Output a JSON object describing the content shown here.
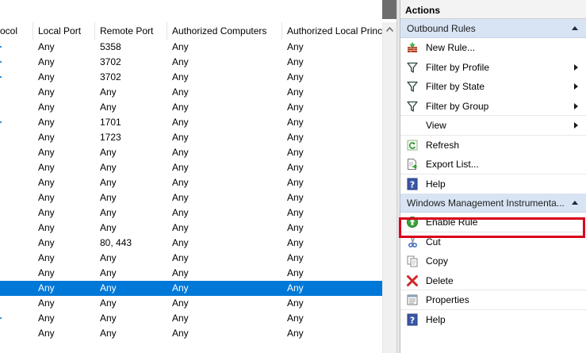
{
  "columns": [
    "ocol",
    "Local Port",
    "Remote Port",
    "Authorized Computers",
    "Authorized Local Princ"
  ],
  "rows": [
    {
      "tick": true,
      "local_port": "Any",
      "remote_port": "5358",
      "auth_computers": "Any",
      "auth_local": "Any",
      "selected": false
    },
    {
      "tick": true,
      "local_port": "Any",
      "remote_port": "3702",
      "auth_computers": "Any",
      "auth_local": "Any",
      "selected": false
    },
    {
      "tick": true,
      "local_port": "Any",
      "remote_port": "3702",
      "auth_computers": "Any",
      "auth_local": "Any",
      "selected": false
    },
    {
      "tick": false,
      "local_port": "Any",
      "remote_port": "Any",
      "auth_computers": "Any",
      "auth_local": "Any",
      "selected": false
    },
    {
      "tick": false,
      "local_port": "Any",
      "remote_port": "Any",
      "auth_computers": "Any",
      "auth_local": "Any",
      "selected": false
    },
    {
      "tick": true,
      "local_port": "Any",
      "remote_port": "1701",
      "auth_computers": "Any",
      "auth_local": "Any",
      "selected": false
    },
    {
      "tick": false,
      "local_port": "Any",
      "remote_port": "1723",
      "auth_computers": "Any",
      "auth_local": "Any",
      "selected": false
    },
    {
      "tick": false,
      "local_port": "Any",
      "remote_port": "Any",
      "auth_computers": "Any",
      "auth_local": "Any",
      "selected": false
    },
    {
      "tick": false,
      "local_port": "Any",
      "remote_port": "Any",
      "auth_computers": "Any",
      "auth_local": "Any",
      "selected": false
    },
    {
      "tick": false,
      "local_port": "Any",
      "remote_port": "Any",
      "auth_computers": "Any",
      "auth_local": "Any",
      "selected": false
    },
    {
      "tick": false,
      "local_port": "Any",
      "remote_port": "Any",
      "auth_computers": "Any",
      "auth_local": "Any",
      "selected": false
    },
    {
      "tick": false,
      "local_port": "Any",
      "remote_port": "Any",
      "auth_computers": "Any",
      "auth_local": "Any",
      "selected": false
    },
    {
      "tick": false,
      "local_port": "Any",
      "remote_port": "Any",
      "auth_computers": "Any",
      "auth_local": "Any",
      "selected": false
    },
    {
      "tick": false,
      "local_port": "Any",
      "remote_port": "80, 443",
      "auth_computers": "Any",
      "auth_local": "Any",
      "selected": false
    },
    {
      "tick": false,
      "local_port": "Any",
      "remote_port": "Any",
      "auth_computers": "Any",
      "auth_local": "Any",
      "selected": false
    },
    {
      "tick": false,
      "local_port": "Any",
      "remote_port": "Any",
      "auth_computers": "Any",
      "auth_local": "Any",
      "selected": false
    },
    {
      "tick": false,
      "local_port": "Any",
      "remote_port": "Any",
      "auth_computers": "Any",
      "auth_local": "Any",
      "selected": true
    },
    {
      "tick": false,
      "local_port": "Any",
      "remote_port": "Any",
      "auth_computers": "Any",
      "auth_local": "Any",
      "selected": false
    },
    {
      "tick": true,
      "local_port": "Any",
      "remote_port": "Any",
      "auth_computers": "Any",
      "auth_local": "Any",
      "selected": false
    },
    {
      "tick": false,
      "local_port": "Any",
      "remote_port": "Any",
      "auth_computers": "Any",
      "auth_local": "Any",
      "selected": false
    }
  ],
  "actions": {
    "title": "Actions",
    "section1": {
      "title": "Outbound Rules",
      "items": [
        {
          "label": "New Rule...",
          "icon": "new-rule-icon"
        },
        {
          "label": "Filter by Profile",
          "icon": "filter-icon"
        },
        {
          "label": "Filter by State",
          "icon": "filter-icon"
        },
        {
          "label": "Filter by Group",
          "icon": "filter-icon"
        },
        {
          "label": "View",
          "icon": ""
        },
        {
          "label": "Refresh",
          "icon": "refresh-icon"
        },
        {
          "label": "Export List...",
          "icon": "export-icon"
        },
        {
          "label": "Help",
          "icon": "help-icon"
        }
      ]
    },
    "section2": {
      "title": "Windows Management Instrumenta...",
      "items": [
        {
          "label": "Enable Rule",
          "icon": "enable-icon"
        },
        {
          "label": "Cut",
          "icon": "cut-icon"
        },
        {
          "label": "Copy",
          "icon": "copy-icon"
        },
        {
          "label": "Delete",
          "icon": "delete-icon"
        },
        {
          "label": "Properties",
          "icon": "properties-icon"
        },
        {
          "label": "Help",
          "icon": "help-icon"
        }
      ]
    }
  },
  "colors": {
    "selection": "#0078d7",
    "section_header": "#d8e4f4",
    "highlight_box": "#d9001b"
  }
}
